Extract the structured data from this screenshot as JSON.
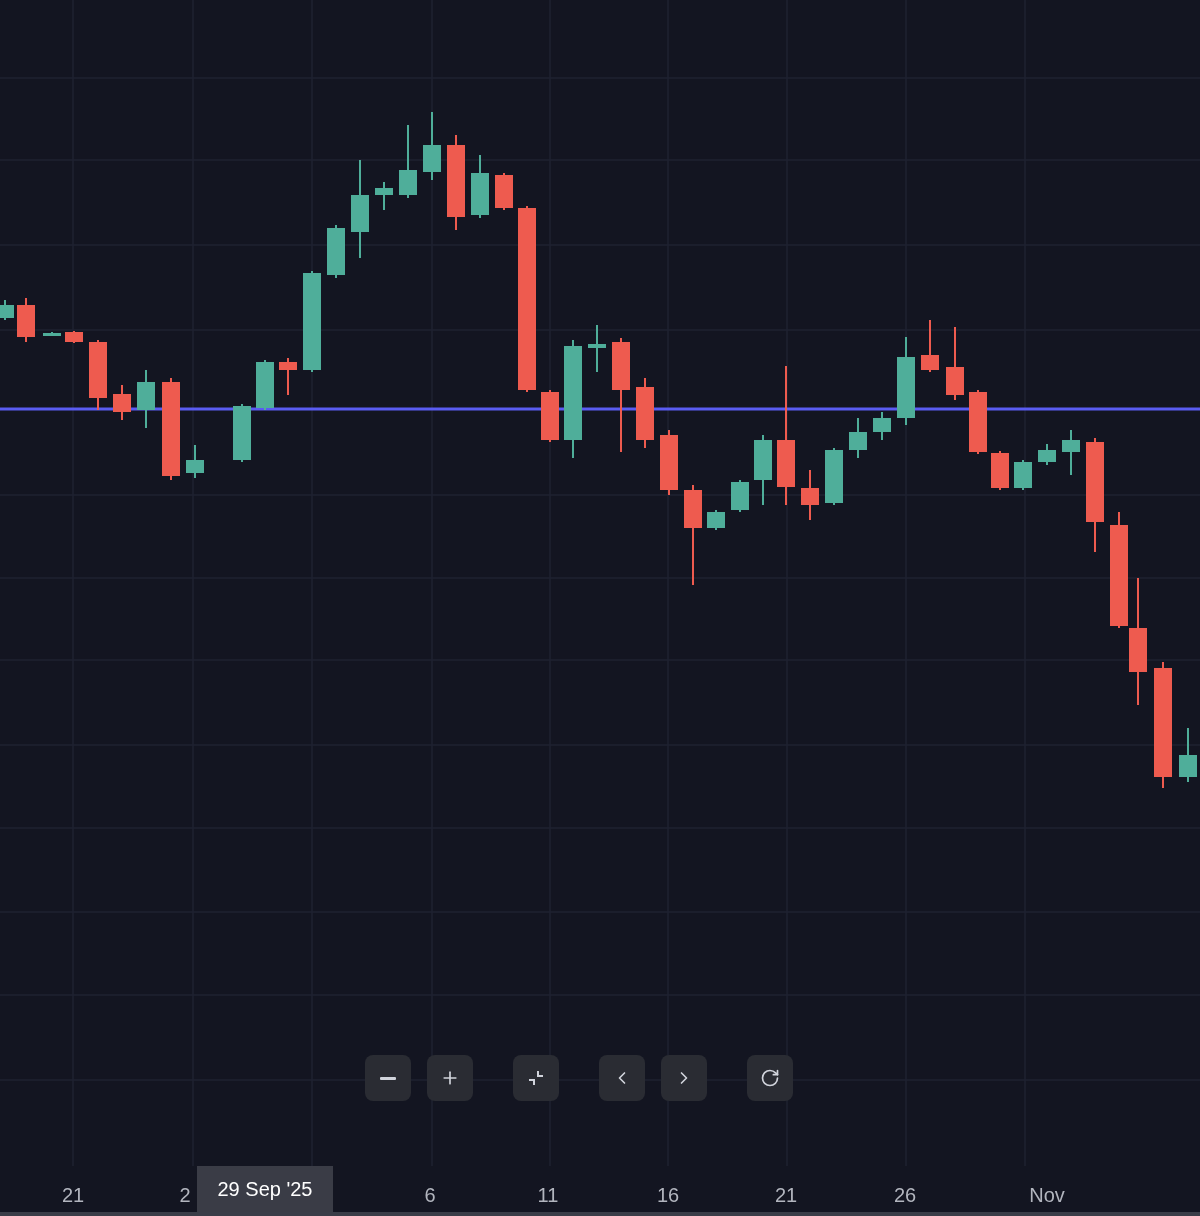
{
  "time_axis": {
    "labels": [
      "21",
      "2",
      "6",
      "11",
      "16",
      "21",
      "26",
      "Nov"
    ],
    "crosshair_label": "29 Sep '25"
  }
}
